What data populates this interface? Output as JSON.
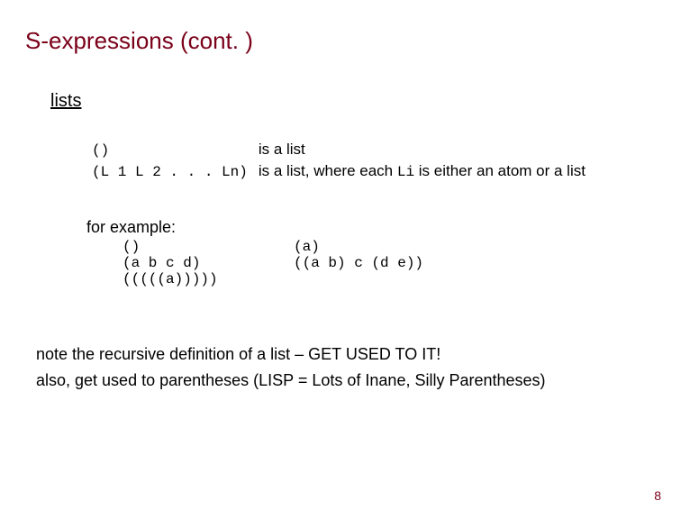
{
  "title": "S-expressions (cont. )",
  "section_heading": "lists",
  "definitions": {
    "row1": {
      "code": "()",
      "desc": "is a list"
    },
    "row2": {
      "code": "(L 1 L 2 . . . Ln)",
      "desc_before": "is a list, where each ",
      "li": "Li",
      "desc_after": " is either an atom or a list"
    }
  },
  "for_example_label": "for example:",
  "examples": {
    "left": [
      "()",
      "(a b c d)",
      "(((((a)))))"
    ],
    "right": [
      "(a)",
      "((a b) c (d e))"
    ]
  },
  "notes": {
    "line1": "note the recursive definition of a list – GET USED TO IT!",
    "line2": "also, get used to parentheses (LISP = Lots of Inane, Silly Parentheses)"
  },
  "page_number": "8"
}
